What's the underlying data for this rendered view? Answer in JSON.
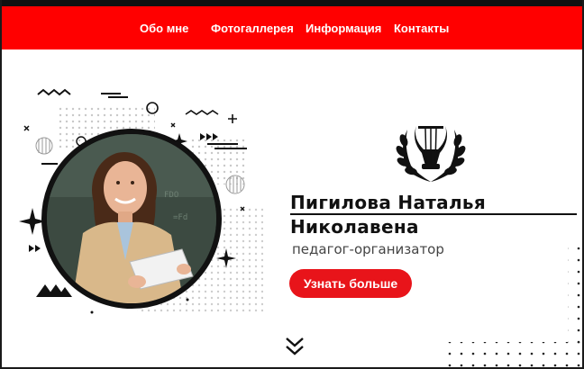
{
  "nav": {
    "items": [
      "Обо мне",
      "Фотогаллерея",
      "Информация",
      "Контакты"
    ]
  },
  "profile": {
    "name_line1": "Пигилова Наталья",
    "name_line2": "Николавена",
    "role": "педагог-организатор",
    "cta_label": "Узнать больше"
  },
  "icons": {
    "logo": "lyre-laurel-icon",
    "scroll": "double-chevron-down-icon"
  },
  "colors": {
    "accent": "#ff0000",
    "button": "#e8141a",
    "text": "#111111"
  }
}
